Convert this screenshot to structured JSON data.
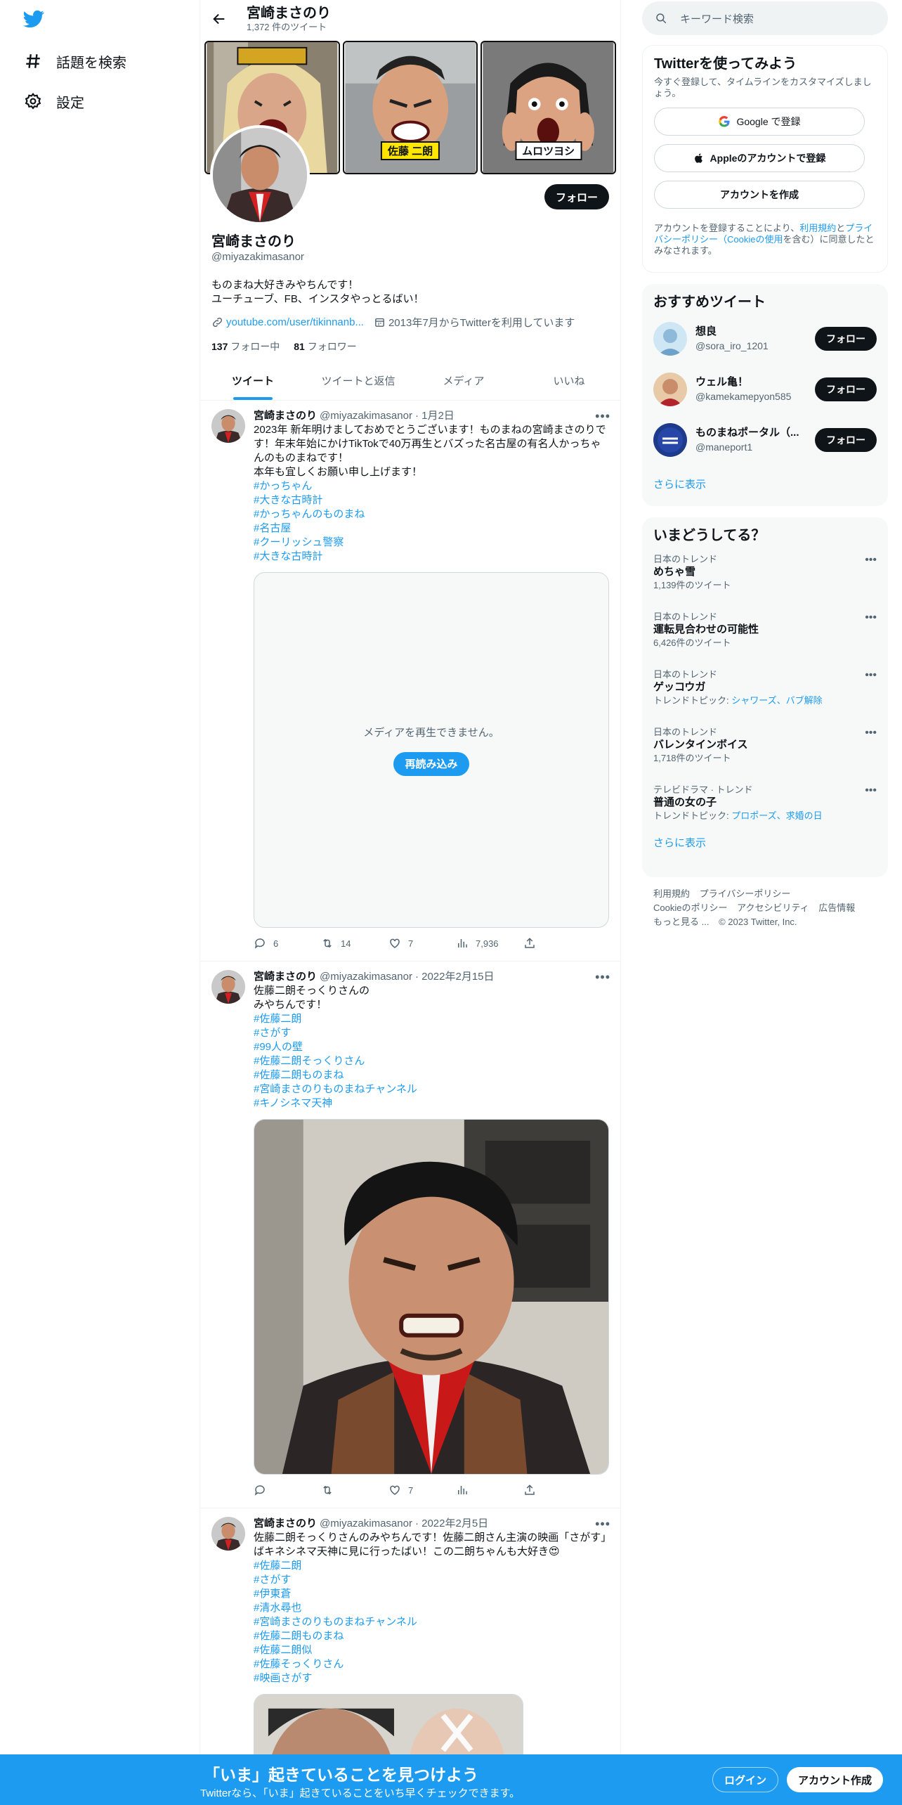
{
  "nav": {
    "explore_label": "話題を検索",
    "settings_label": "設定"
  },
  "profile": {
    "name": "宮崎まさのり",
    "tweet_count": "1,372 件のツイート",
    "handle": "@miyazakimasanor",
    "bio": "ものまね大好きみやちんです！\nユーチューブ、FB、インスタやっとるばい！",
    "link": "youtube.com/user/tikinnanb...",
    "joined": "2013年7月からTwitterを利用しています",
    "following_count": "137",
    "following_label": "フォロー中",
    "followers_count": "81",
    "followers_label": "フォロワー",
    "follow_label": "フォロー",
    "banner_labels": [
      "佐藤 二朗",
      "ムロツヨシ"
    ]
  },
  "tabs": [
    "ツイート",
    "ツイートと返信",
    "メディア",
    "いいね"
  ],
  "tweets": [
    {
      "name": "宮崎まさのり",
      "handle": "@miyazakimasanor",
      "date": "· 1月2日",
      "text": "2023年 新年明けましておめでとうございます！ものまねの宮崎まさのりです！年末年始にかけTikTokで40万再生とバズった名古屋の有名人かっちゃんのものまねです！\n本年も宜しくお願い申し上げます！",
      "tags": [
        "#かっちゃん",
        "#大きな古時計",
        "#かっちゃんのものまね",
        "#名古屋",
        "#クーリッシュ警察",
        "#大きな古時計"
      ],
      "media_message": "メディアを再生できません。",
      "reload_label": "再読み込み",
      "replies": "6",
      "retweets": "14",
      "likes": "7",
      "views": "7,936"
    },
    {
      "name": "宮崎まさのり",
      "handle": "@miyazakimasanor",
      "date": "· 2022年2月15日",
      "text": "佐藤二朗そっくりさんの\nみやちんです！",
      "tags": [
        "#佐藤二朗",
        "#さがす",
        "#99人の壁",
        "#佐藤二朗そっくりさん",
        "#佐藤二朗ものまね",
        "#宮崎まさのりものまねチャンネル",
        "#キノシネマ天神"
      ],
      "likes": "7"
    },
    {
      "name": "宮崎まさのり",
      "handle": "@miyazakimasanor",
      "date": "· 2022年2月5日",
      "text": "佐藤二朗そっくりさんのみやちんです！佐藤二朗さん主演の映画「さがす」ばキネシネマ天神に見に行ったばい！この二朗ちゃんも大好き😍",
      "tags": [
        "#佐藤二朗",
        "#さがす",
        "#伊東蒼",
        "#清水尋也",
        "#宮崎まさのりものまねチャンネル",
        "#佐藤二朗ものまね",
        "#佐藤二朗似",
        "#佐藤そっくりさん",
        "#映画さがす"
      ]
    }
  ],
  "search": {
    "placeholder": "キーワード検索"
  },
  "signup": {
    "title": "Twitterを使ってみよう",
    "subtitle": "今すぐ登録して、タイムラインをカスタマイズしましょう。",
    "google": "Google で登録",
    "apple": "Appleのアカウントで登録",
    "create": "アカウントを作成",
    "terms_prefix": "アカウントを登録することにより、",
    "terms_link1": "利用規約",
    "terms_mid1": "と",
    "terms_link2": "プライバシーポリシー（Cookieの使用",
    "terms_suffix": "を含む）に同意したとみなされます。"
  },
  "recommended": {
    "title": "おすすめツイート",
    "users": [
      {
        "name": "想良",
        "handle": "@sora_iro_1201",
        "button": "フォロー"
      },
      {
        "name": "ウェル亀！",
        "handle": "@kamekamepyon585",
        "button": "フォロー"
      },
      {
        "name": "ものまねポータル（...",
        "handle": "@maneport1",
        "button": "フォロー"
      }
    ],
    "show_more": "さらに表示"
  },
  "trends": {
    "title": "いまどうしてる？",
    "items": [
      {
        "context": "日本のトレンド",
        "topic": "めちゃ雪",
        "meta": "1,139件のツイート"
      },
      {
        "context": "日本のトレンド",
        "topic": "運転見合わせの可能性",
        "meta": "6,426件のツイート"
      },
      {
        "context": "日本のトレンド",
        "topic": "ゲッコウガ",
        "meta_prefix": "トレンドトピック: ",
        "meta_links": "シャワーズ、バブ解除"
      },
      {
        "context": "日本のトレンド",
        "topic": "バレンタインボイス",
        "meta": "1,718件のツイート"
      },
      {
        "context": "テレビドラマ · トレンド",
        "topic": "普通の女の子",
        "meta_prefix": "トレンドトピック: ",
        "meta_links": "プロポーズ、求婚の日"
      }
    ],
    "show_more": "さらに表示"
  },
  "footer": {
    "links": [
      "利用規約",
      "プライバシーポリシー",
      "Cookieのポリシー",
      "アクセシビリティ",
      "広告情報",
      "もっと見る ...",
      "© 2023 Twitter, Inc."
    ]
  },
  "bottombar": {
    "headline": "「いま」起きていることを見つけよう",
    "subline": "Twitterなら、「いま」起きていることをいち早くチェックできます。",
    "login": "ログイン",
    "signup": "アカウント作成"
  },
  "colors": {
    "brand": "#1d9bf0",
    "text": "#0f1419",
    "muted": "#536471"
  }
}
